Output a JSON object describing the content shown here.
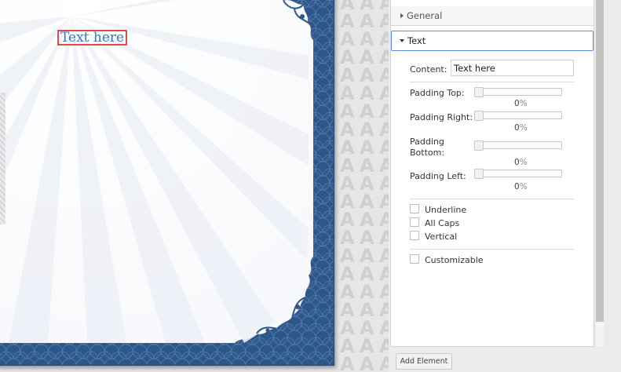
{
  "canvas": {
    "text_element": "Text here",
    "background_letter": "A"
  },
  "panel": {
    "sections": {
      "general": "General",
      "text": "Text"
    },
    "content": {
      "label": "Content:",
      "value": "Text here"
    },
    "sliders": [
      {
        "label": "Padding Top:",
        "value": "0",
        "unit": "%",
        "level": 0
      },
      {
        "label": "Padding Right:",
        "value": "0",
        "unit": "%",
        "level": 0
      },
      {
        "label_line1": "Padding",
        "label_line2": "Bottom:",
        "value": "0",
        "unit": "%",
        "level": 0
      },
      {
        "label": "Padding Left:",
        "value": "0",
        "unit": "%",
        "level": 0
      }
    ],
    "checkboxes": [
      {
        "label": "Underline",
        "checked": false
      },
      {
        "label": "All Caps",
        "checked": false
      },
      {
        "label": "Vertical",
        "checked": false
      },
      {
        "label": "Customizable",
        "checked": false
      }
    ]
  },
  "footer": {
    "add_element": "Add Element"
  },
  "colors": {
    "border_blue": "#2d5689",
    "selection_red": "#e04a4a",
    "text_blue": "#3d78b6",
    "header_focus": "#5a8ed6"
  }
}
